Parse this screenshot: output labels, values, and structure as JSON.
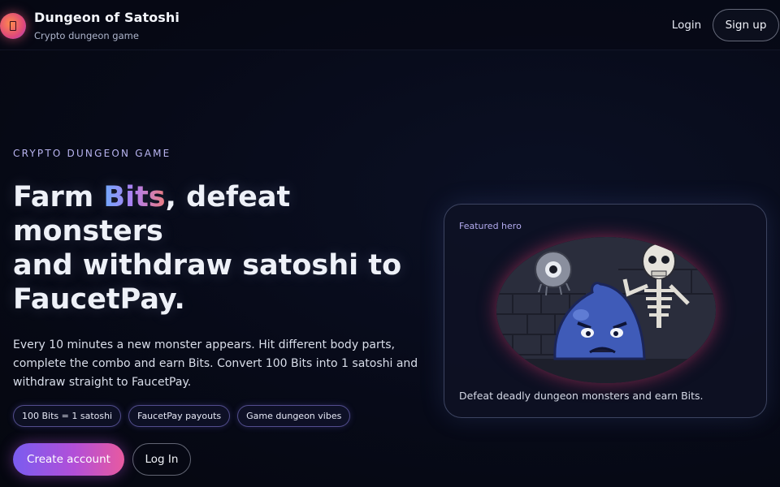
{
  "header": {
    "logo_icon": "dungeon-door-icon",
    "title": "Dungeon of Satoshi",
    "subtitle": "Crypto dungeon game",
    "login_label": "Login",
    "signup_label": "Sign up"
  },
  "hero": {
    "eyebrow": "CRYPTO DUNGEON GAME",
    "headline_pre": "Farm ",
    "headline_accent": "Bits",
    "headline_line1_post": ", defeat",
    "headline_line2": "monsters",
    "headline_line3": "and withdraw satoshi to",
    "headline_line4": "FaucetPay.",
    "description": "Every 10 minutes a new monster appears. Hit different body parts, complete the combo and earn Bits. Convert 100 Bits into 1 satoshi and withdraw straight to FaucetPay.",
    "pills": [
      "100 Bits = 1 satoshi",
      "FaucetPay payouts",
      "Game dungeon vibes"
    ],
    "create_label": "Create account",
    "login_label": "Log In"
  },
  "card": {
    "label": "Featured hero",
    "caption": "Defeat deadly dungeon monsters and earn Bits.",
    "art_icons": [
      "eyeball-monster-icon",
      "blue-slime-monster-icon",
      "skeleton-monster-icon"
    ]
  },
  "colors": {
    "accent_gradient": [
      "#7a5cf0",
      "#b24fd8",
      "#e85aa0"
    ],
    "background": "#070a18",
    "glow": "#e03c6e"
  }
}
